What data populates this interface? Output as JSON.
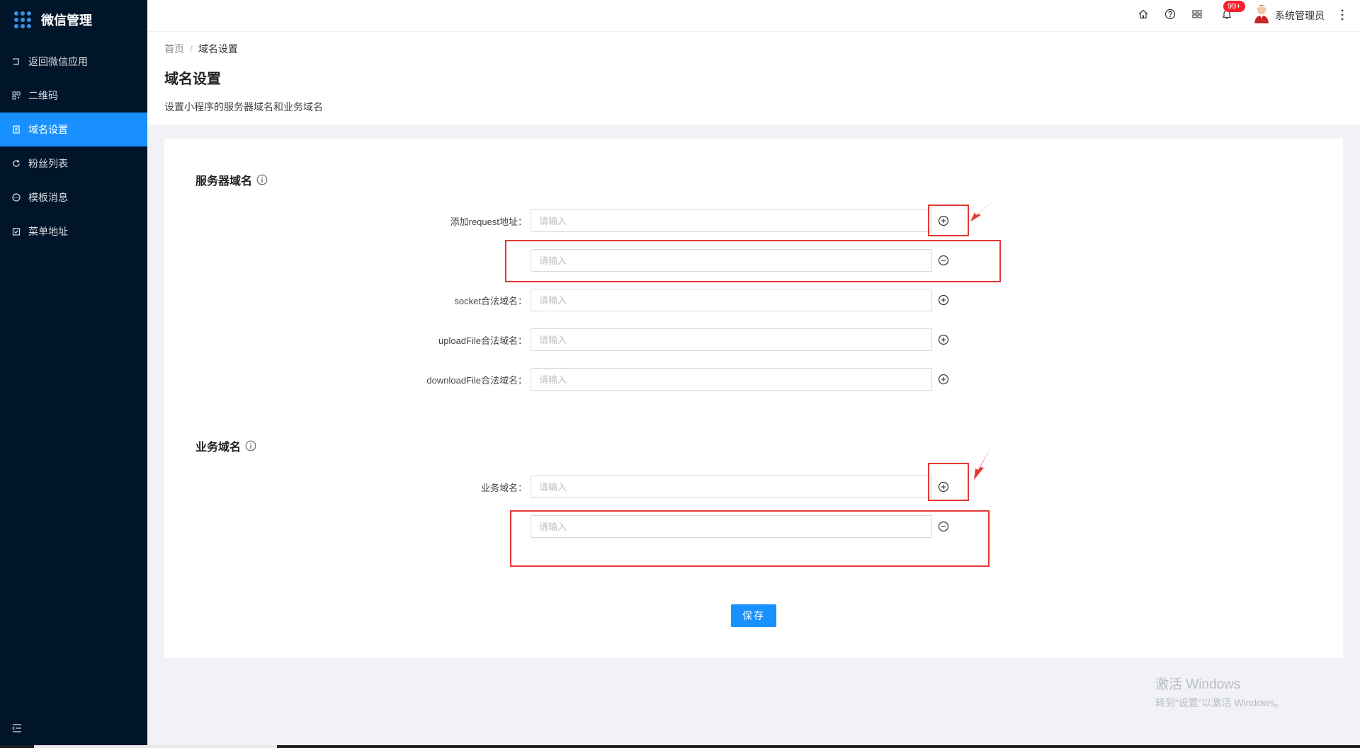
{
  "app": {
    "title": "微信管理"
  },
  "sidebar": {
    "items": [
      {
        "label": "返回微信应用",
        "icon": "return-icon"
      },
      {
        "label": "二维码",
        "icon": "qrcode-icon"
      },
      {
        "label": "域名设置",
        "icon": "document-icon",
        "active": true
      },
      {
        "label": "粉丝列表",
        "icon": "refresh-icon"
      },
      {
        "label": "模板消息",
        "icon": "message-icon"
      },
      {
        "label": "菜单地址",
        "icon": "checklist-icon"
      }
    ]
  },
  "header": {
    "badge": "99+",
    "user_name": "系统管理员"
  },
  "breadcrumb": {
    "home": "首页",
    "separator": "/",
    "current": "域名设置"
  },
  "page": {
    "title": "域名设置",
    "description": "设置小程序的服务器域名和业务域名"
  },
  "server_section": {
    "title": "服务器域名",
    "rows": [
      {
        "label": "添加request地址：",
        "placeholder": "请输入",
        "action": "add"
      },
      {
        "label": "",
        "placeholder": "请输入",
        "action": "remove"
      },
      {
        "label": "socket合法域名：",
        "placeholder": "请输入",
        "action": "add"
      },
      {
        "label": "uploadFile合法域名：",
        "placeholder": "请输入",
        "action": "add"
      },
      {
        "label": "downloadFile合法域名：",
        "placeholder": "请输入",
        "action": "add"
      }
    ]
  },
  "business_section": {
    "title": "业务域名",
    "rows": [
      {
        "label": "业务域名：",
        "placeholder": "请输入",
        "action": "add"
      },
      {
        "label": "",
        "placeholder": "请输入",
        "action": "remove"
      }
    ]
  },
  "actions": {
    "save_label": "保存"
  },
  "watermark": {
    "title": "激活 Windows",
    "subtitle": "转到“设置”以激活 Windows。"
  },
  "colors": {
    "sidebar_bg": "#001529",
    "accent": "#1890ff",
    "annotation_red": "#e53935",
    "badge_red": "#f5222d"
  }
}
